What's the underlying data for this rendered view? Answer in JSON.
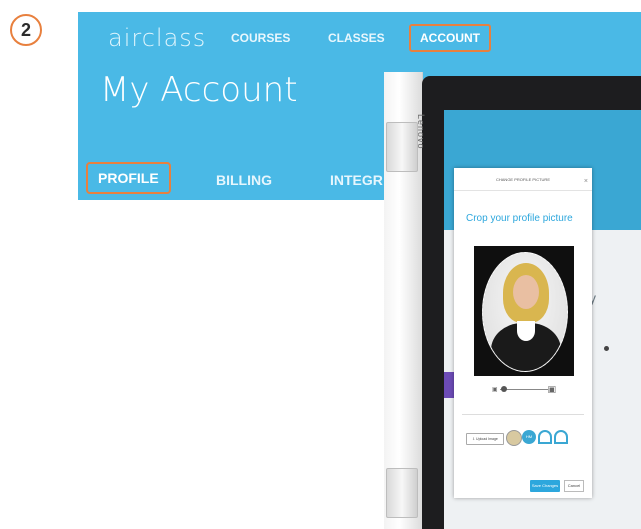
{
  "step": {
    "number": "2"
  },
  "app": {
    "logo": "airclass",
    "nav": {
      "courses": "COURSES",
      "classes": "CLASSES",
      "account": "ACCOUNT"
    },
    "page_title": "My Account",
    "tabs": {
      "profile": "PROFILE",
      "billing": "BILLING",
      "integrations": "INTEGR"
    }
  },
  "tablet": {
    "brand": "Lenovo",
    "screen_letter": "y"
  },
  "modal": {
    "header": "CHANGE PROFILE PICTURE",
    "close": "×",
    "heading": "Crop your profile picture",
    "upload_label": "⇩ Upload Image",
    "initials": "HM",
    "save_label": "Save Changes",
    "cancel_label": "Cancel"
  },
  "colors": {
    "header_blue": "#4ab9e6",
    "highlight_orange": "#e8803e",
    "accent_blue": "#2da7dd"
  }
}
